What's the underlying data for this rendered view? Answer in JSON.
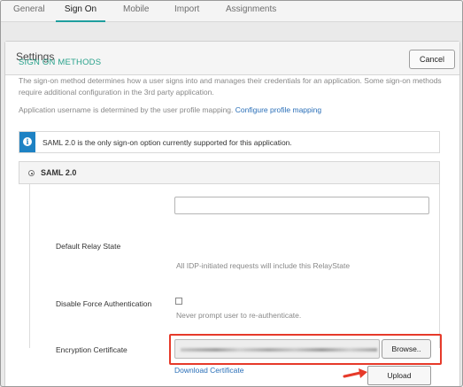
{
  "tabs": [
    {
      "label": "General"
    },
    {
      "label": "Sign On",
      "active": true
    },
    {
      "label": "Mobile"
    },
    {
      "label": "Import"
    },
    {
      "label": "Assignments"
    }
  ],
  "panel": {
    "title": "Settings",
    "cancel_label": "Cancel"
  },
  "sign_on": {
    "section_title": "SIGN ON METHODS",
    "description": "The sign-on method determines how a user signs into and manages their credentials for an application. Some sign-on methods require additional configuration in the 3rd party application.",
    "username_text": "Application username is determined by the user profile mapping.",
    "username_link": "Configure profile mapping",
    "info_text": "SAML 2.0 is the only sign-on option currently supported for this application.",
    "info_icon": "i",
    "saml_label": "SAML 2.0"
  },
  "form": {
    "relay_state_label": "Default Relay State",
    "relay_state_value": "",
    "relay_state_hint": "All IDP-initiated requests will include this RelayState",
    "force_auth_label": "Disable Force Authentication",
    "force_auth_checked": false,
    "force_auth_hint": "Never prompt user to re-authenticate.",
    "encryption_label": "Encryption Certificate",
    "browse_label": "Browse..",
    "download_label": "Download Certificate",
    "upload_label": "Upload"
  },
  "colors": {
    "accent_teal": "#1f9e9e",
    "section_green": "#2aa28c",
    "link_blue": "#2a6fb8",
    "info_blue": "#1e82c4",
    "highlight_red": "#e63a2a"
  }
}
